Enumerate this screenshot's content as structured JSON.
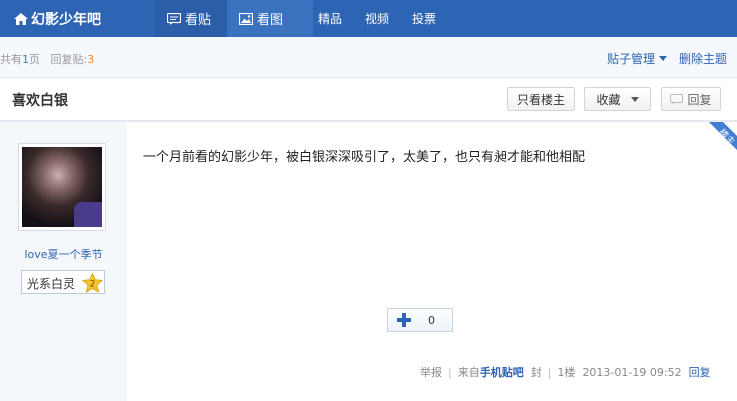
{
  "nav": {
    "brand": "幻影少年吧",
    "tab_posts": "看贴",
    "tab_pics": "看图",
    "links": [
      "精品",
      "视频",
      "投票"
    ]
  },
  "info": {
    "pages_prefix": "共有",
    "pages_num": "1",
    "pages_suffix": "页",
    "replies_label": "回复贴:",
    "replies_num": "3",
    "manage_label": "贴子管理",
    "delete_label": "删除主题"
  },
  "thread": {
    "title": "喜欢白银",
    "only_op_label": "只看楼主",
    "favorite_label": "收藏",
    "reply_label": "回复"
  },
  "post": {
    "username": "love夏一个季节",
    "rank_title": "光系白灵",
    "rank_level": "2",
    "op_badge": "楼主",
    "content": "一个月前看的幻影少年，被白银深深吸引了，太美了，也只有昶才能和他相配",
    "like_count": "0",
    "report_label": "举报",
    "source_prefix": "来自",
    "source_name": "手机贴吧",
    "block_label": "封",
    "floor": "1楼",
    "timestamp": "2013-01-19 09:52",
    "reply_link": "回复"
  },
  "colors": {
    "brand_blue": "#2d64b3",
    "accent_orange": "#f08a24",
    "badge_blue": "#3f7fd2"
  }
}
